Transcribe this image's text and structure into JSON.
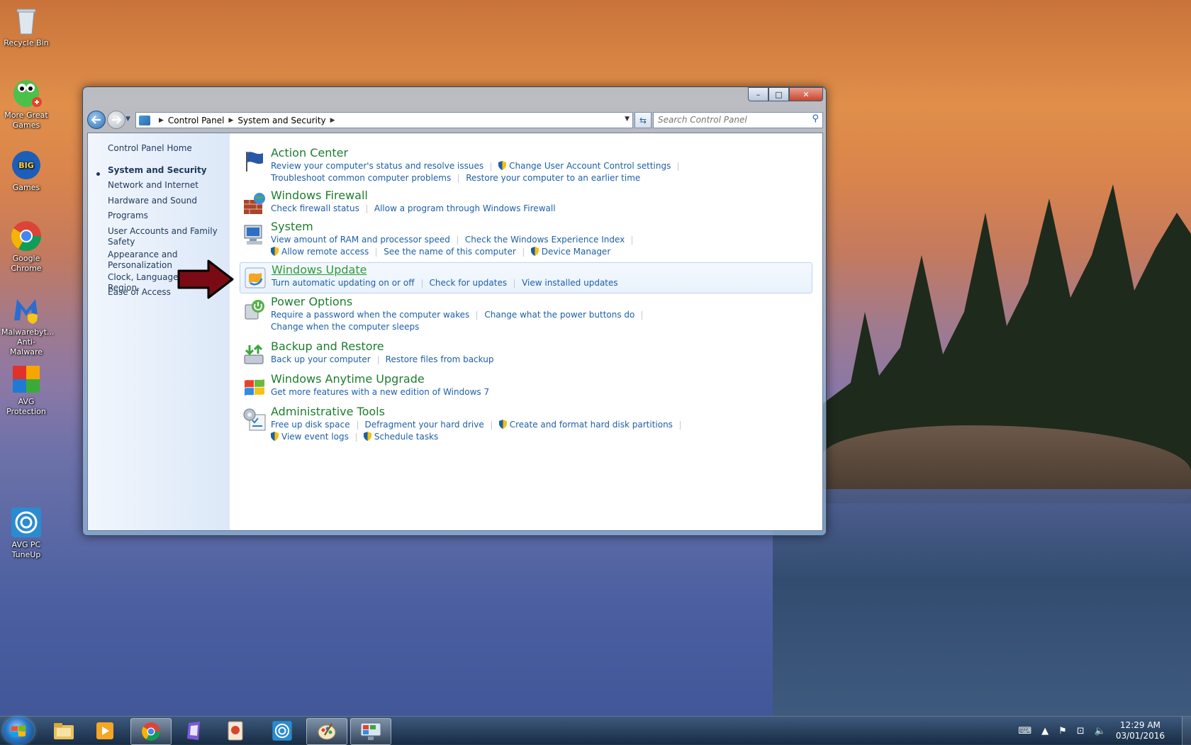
{
  "desktop_icons": [
    {
      "label": "Recycle Bin",
      "icon": "recycle-bin-icon"
    },
    {
      "label": "More Great Games",
      "icon": "more-great-games-icon"
    },
    {
      "label": "Games",
      "icon": "big-fish-games-icon"
    },
    {
      "label": "Google Chrome",
      "icon": "chrome-icon"
    },
    {
      "label": "Malwarebyt... Anti-Malware",
      "icon": "malwarebytes-icon"
    },
    {
      "label": "AVG Protection",
      "icon": "avg-icon"
    },
    {
      "label": "AVG PC TuneUp",
      "icon": "avg-tuneup-icon"
    }
  ],
  "window": {
    "caption_buttons": {
      "minimize": "–",
      "maximize": "□",
      "close": "✕"
    },
    "address": {
      "crumbs": [
        "Control Panel",
        "System and Security"
      ]
    },
    "search": {
      "placeholder": "Search Control Panel"
    }
  },
  "left_pane": {
    "home": "Control Panel Home",
    "items": [
      "System and Security",
      "Network and Internet",
      "Hardware and Sound",
      "Programs",
      "User Accounts and Family Safety",
      "Appearance and Personalization",
      "Clock, Language, and Region",
      "Ease of Access"
    ],
    "selected": "System and Security"
  },
  "categories": {
    "action_center": {
      "title": "Action Center",
      "links": [
        "Review your computer's status and resolve issues",
        "Change User Account Control settings",
        "Troubleshoot common computer problems",
        "Restore your computer to an earlier time"
      ]
    },
    "firewall": {
      "title": "Windows Firewall",
      "links": [
        "Check firewall status",
        "Allow a program through Windows Firewall"
      ]
    },
    "system": {
      "title": "System",
      "links": [
        "View amount of RAM and processor speed",
        "Check the Windows Experience Index",
        "Allow remote access",
        "See the name of this computer",
        "Device Manager"
      ]
    },
    "windows_update": {
      "title": "Windows Update",
      "links": [
        "Turn automatic updating on or off",
        "Check for updates",
        "View installed updates"
      ]
    },
    "power": {
      "title": "Power Options",
      "links": [
        "Require a password when the computer wakes",
        "Change what the power buttons do",
        "Change when the computer sleeps"
      ]
    },
    "backup": {
      "title": "Backup and Restore",
      "links": [
        "Back up your computer",
        "Restore files from backup"
      ]
    },
    "anytime": {
      "title": "Windows Anytime Upgrade",
      "links": [
        "Get more features with a new edition of Windows 7"
      ]
    },
    "admin": {
      "title": "Administrative Tools",
      "links": [
        "Free up disk space",
        "Defragment your hard drive",
        "Create and format hard disk partitions",
        "View event logs",
        "Schedule tasks"
      ]
    }
  },
  "taskbar": {
    "items": [
      "explorer-icon",
      "media-player-icon",
      "chrome-icon",
      "app-icon",
      "app-icon",
      "avg-tuneup-icon",
      "paint-icon",
      "control-panel-icon"
    ],
    "clock": {
      "time": "12:29 AM",
      "date": "03/01/2016"
    }
  },
  "colors": {
    "link": "#1d5fa8",
    "category_title": "#1e7d2f",
    "nav_text": "#1e395b"
  }
}
